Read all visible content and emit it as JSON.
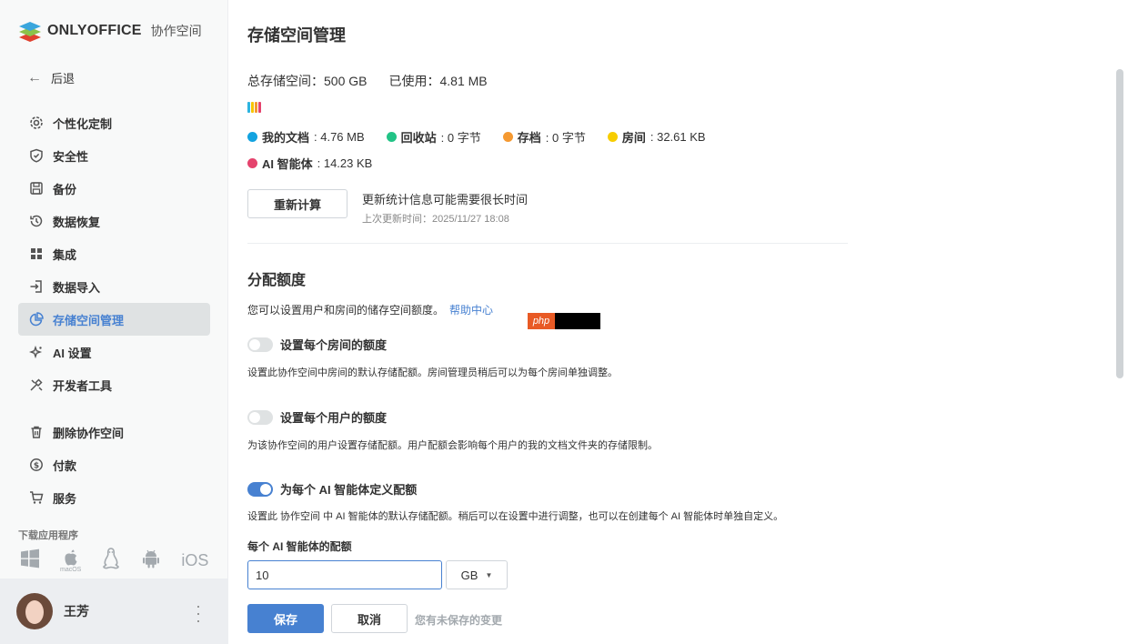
{
  "logo": {
    "brand": "ONLYOFFICE",
    "sub": "协作空间"
  },
  "sidebar": {
    "back_label": "后退",
    "items": [
      {
        "label": "个性化定制",
        "icon": "gear-icon"
      },
      {
        "label": "安全性",
        "icon": "shield-icon"
      },
      {
        "label": "备份",
        "icon": "save-icon"
      },
      {
        "label": "数据恢复",
        "icon": "history-icon"
      },
      {
        "label": "集成",
        "icon": "grid-icon"
      },
      {
        "label": "数据导入",
        "icon": "import-icon"
      },
      {
        "label": "存储空间管理",
        "icon": "pie-chart-icon",
        "active": true
      },
      {
        "label": "AI 设置",
        "icon": "sparkle-icon"
      },
      {
        "label": "开发者工具",
        "icon": "tools-icon"
      },
      {
        "label": "删除协作空间",
        "icon": "trash-icon"
      },
      {
        "label": "付款",
        "icon": "dollar-icon"
      },
      {
        "label": "服务",
        "icon": "cart-icon"
      }
    ],
    "download_title": "下载应用程序",
    "download_apps": [
      "windows-icon",
      "macos-icon",
      "linux-icon",
      "android-icon",
      "ios-icon"
    ],
    "macos_label": "macOS",
    "ios_label": "iOS"
  },
  "profile": {
    "name": "王芳"
  },
  "main": {
    "title": "存储空间管理",
    "total_label": "总存储空间：500 GB",
    "used_label": "已使用：4.81 MB",
    "usage_colors": [
      "#2db4e0",
      "#f7c500",
      "#f59931",
      "#e5436d"
    ],
    "legend": [
      {
        "name": "我的文档",
        "value": ": 4.76 MB",
        "color": "#13a3e0"
      },
      {
        "name": "回收站",
        "value": ": 0 字节",
        "color": "#22c386"
      },
      {
        "name": "存档",
        "value": ": 0 字节",
        "color": "#f59931"
      },
      {
        "name": "房间",
        "value": ": 32.61 KB",
        "color": "#f7cd00"
      },
      {
        "name": "AI 智能体",
        "value": ": 14.23 KB",
        "color": "#e5436d"
      }
    ],
    "recalc_button": "重新计算",
    "recalc_note": "更新统计信息可能需要很长时间",
    "last_update": "上次更新时间：2025/11/27 18:08",
    "quota_title": "分配额度",
    "quota_desc": "您可以设置用户和房间的储存空间额度。",
    "help_link": "帮助中心",
    "php_badge": "php",
    "room_quota": {
      "label": "设置每个房间的额度",
      "on": false,
      "desc": "设置此协作空间中房间的默认存储配额。房间管理员稍后可以为每个房间单独调整。"
    },
    "user_quota": {
      "label": "设置每个用户的额度",
      "on": false,
      "desc": "为该协作空间的用户设置存储配额。用户配额会影响每个用户的我的文档文件夹的存储限制。"
    },
    "ai_quota": {
      "label": "为每个 AI 智能体定义配额",
      "on": true,
      "desc": "设置此 协作空间 中 AI 智能体的默认存储配额。稍后可以在设置中进行调整，也可以在创建每个 AI 智能体时单独自定义。"
    },
    "ai_field_label": "每个 AI 智能体的配额",
    "ai_field_value": "10",
    "unit": "GB",
    "save_button": "保存",
    "cancel_button": "取消",
    "unsaved_note": "您有未保存的变更"
  }
}
